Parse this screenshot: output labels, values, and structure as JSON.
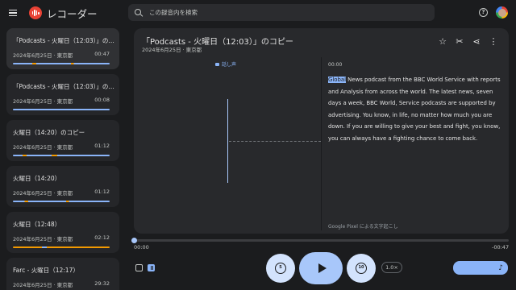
{
  "header": {
    "app_title": "レコーダー",
    "search_placeholder": "この録音内を検索",
    "help_label": "?"
  },
  "recordings": [
    {
      "title": "「Podcasts - 火曜日（12:03）」のコ…",
      "meta": "2024年6月25日 · 東京都",
      "duration": "00:47",
      "active": true
    },
    {
      "title": "「Podcasts - 火曜日（12:03）」のコ…",
      "meta": "2024年6月25日 · 東京都",
      "duration": "00:08",
      "active": false
    },
    {
      "title": "火曜日（14:20）のコピー",
      "meta": "2024年6月25日 · 東京都",
      "duration": "01:12",
      "active": false
    },
    {
      "title": "火曜日（14:20）",
      "meta": "2024年6月25日 · 東京都",
      "duration": "01:12",
      "active": false
    },
    {
      "title": "火曜日（12:48）",
      "meta": "2024年6月25日 · 東京都",
      "duration": "02:12",
      "active": false
    },
    {
      "title": "Farc - 火曜日（12:17）",
      "meta": "2024年6月25日 · 東京都",
      "duration": "29:32",
      "active": false
    }
  ],
  "main": {
    "title": "「Podcasts - 火曜日（12:03）」のコピー",
    "subtitle": "2024年6月25日 · 東京都",
    "speaker_label": "話し声",
    "transcript_time": "00:00",
    "transcript_highlight": "Global",
    "transcript_body": " News podcast from the BBC World Service with reports and Analysis from across the world. The latest news, seven days a week, BBC World, Service podcasts are supported by advertising. You know, in life, no matter how much you are down. If you are willing to give your best and fight, you know, you can always have a fighting chance to come back.",
    "transcript_credit": "Google Pixel による文字起こし",
    "actions": {
      "star": "☆",
      "cut": "✂",
      "share": "⋖",
      "more": "⋮"
    }
  },
  "player": {
    "elapsed": "00:00",
    "remaining": "-00:47",
    "progress": 0,
    "rewind_label": "5",
    "forward_label": "10",
    "speed": "1.0×",
    "clip_icon": "♪"
  },
  "colors": {
    "accent": "#a8c7fa",
    "logo_red": "#e94235",
    "bar_blue": "#8ab4f8",
    "bar_orange": "#f29900"
  }
}
